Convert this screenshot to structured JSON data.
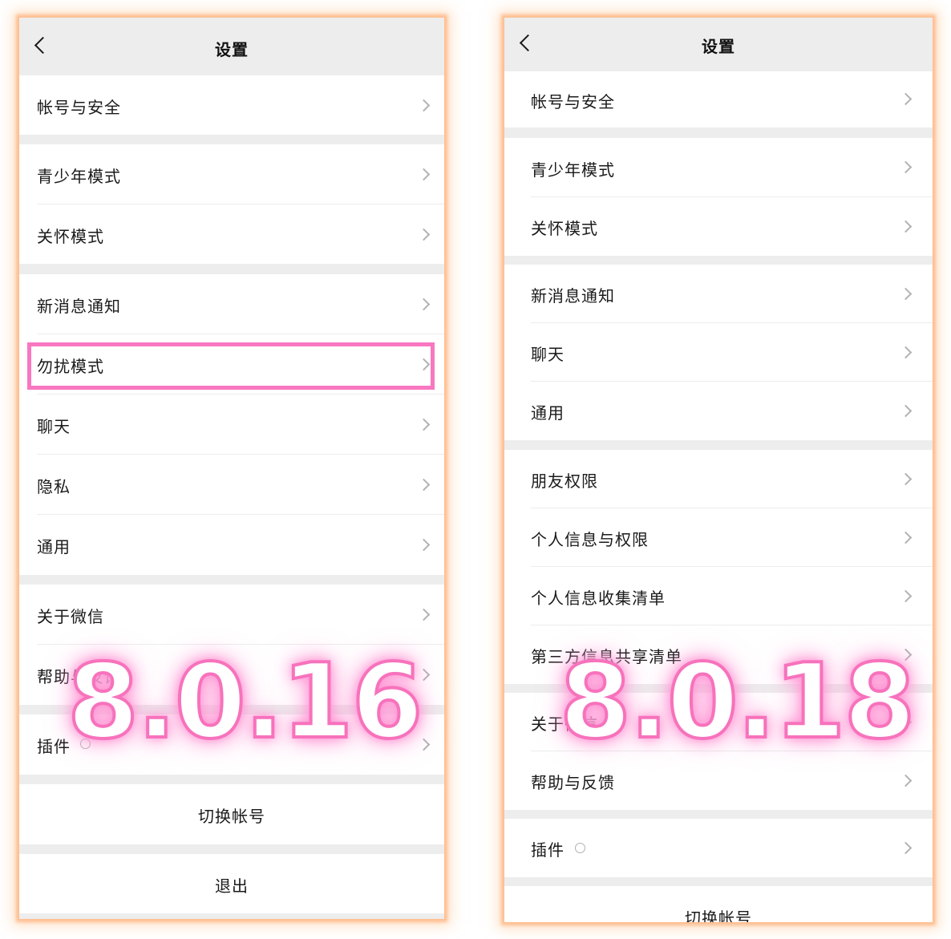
{
  "left_phone": {
    "title": "设置",
    "items": [
      {
        "label": "帐号与安全"
      },
      {
        "label": "青少年模式"
      },
      {
        "label": "关怀模式"
      },
      {
        "label": "新消息通知"
      },
      {
        "label": "勿扰模式"
      },
      {
        "label": "聊天"
      },
      {
        "label": "隐私"
      },
      {
        "label": "通用"
      },
      {
        "label": "关于微信"
      },
      {
        "label": "帮助与反馈"
      },
      {
        "label": "插件"
      }
    ],
    "switch_account": "切换帐号",
    "logout": "退出",
    "version_overlay": "8.0.16"
  },
  "right_phone": {
    "title": "设置",
    "items": [
      {
        "label": "帐号与安全"
      },
      {
        "label": "青少年模式"
      },
      {
        "label": "关怀模式"
      },
      {
        "label": "新消息通知"
      },
      {
        "label": "聊天"
      },
      {
        "label": "通用"
      },
      {
        "label": "朋友权限"
      },
      {
        "label": "个人信息与权限"
      },
      {
        "label": "个人信息收集清单"
      },
      {
        "label": "第三方信息共享清单"
      },
      {
        "label": "关于微信"
      },
      {
        "label": "帮助与反馈"
      },
      {
        "label": "插件"
      }
    ],
    "switch_account": "切换帐号",
    "version_overlay": "8.0.18"
  },
  "colors": {
    "highlight": "#f877c0",
    "glow": "#ffb07a",
    "background": "#ededed"
  }
}
